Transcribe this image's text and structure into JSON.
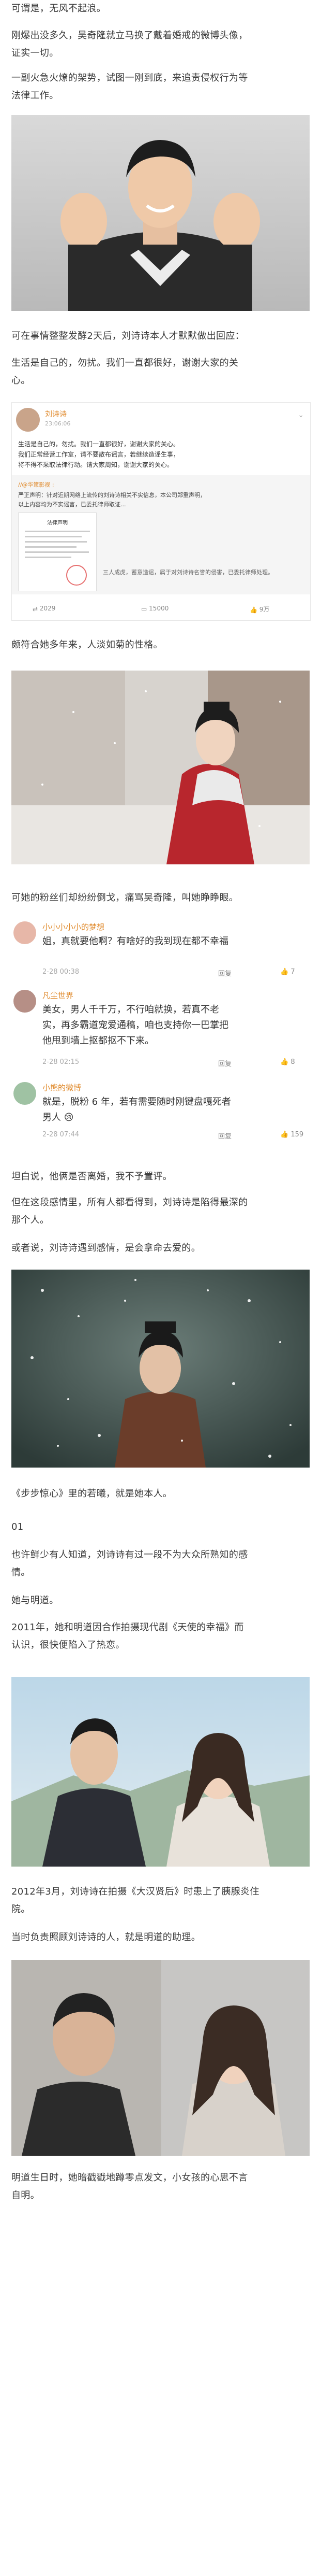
{
  "paragraphs": {
    "p1": "可谓是，无风不起浪。",
    "p2a": "刚爆出没多久，吴奇隆就立马换了戴着婚戒的微博头像，",
    "p2b": "证实一切。",
    "p3a": "一副火急火燎的架势，试图一刚到底，来追责侵权行为等",
    "p3b": "法律工作。",
    "p4": "可在事情整整发酵2天后，刘诗诗本人才默默做出回应：",
    "p5a": "生活是自己的，勿扰。我们一直都很好，谢谢大家的关",
    "p5b": "心。",
    "p6": "颇符合她多年来，人淡如菊的性格。",
    "p7": "可她的粉丝们却纷纷倒戈，痛骂吴奇隆，叫她睁睁眼。",
    "p8": "坦白说，他俩是否离婚，我不予置评。",
    "p9a": "但在这段感情里，所有人都看得到，刘诗诗是陷得最深的",
    "p9b": "那个人。",
    "p10": "或者说，刘诗诗遇到感情，是会拿命去爱的。",
    "p11": "《步步惊心》里的若曦，就是她本人。",
    "p12": "01",
    "p13a": "也许鲜少有人知道，刘诗诗有过一段不为大众所熟知的感",
    "p13b": "情。",
    "p14": "她与明道。",
    "p15a": "2011年，她和明道因合作拍摄现代剧《天使的幸福》而",
    "p15b": "认识，很快便陷入了热恋。",
    "p16a": "2012年3月，刘诗诗在拍摄《大汉贤后》时患上了胰腺炎住",
    "p16b": "院。",
    "p17": "当时负责照顾刘诗诗的人，就是明道的助理。",
    "p18a": "明道生日时，她暗戳戳地蹲零点发文，小女孩的心思不言",
    "p18b": "自明。"
  },
  "weibo_post": {
    "username": "刘诗诗",
    "time": "23:06:06",
    "line1": "生活是自己的，勿扰。我们一直都很好，谢谢大家的关心。",
    "line2": "我们正常经营工作室，请不要散布谣言，若继续造谣生事，",
    "line3": "将不得不采取法律行动。请大家周知，谢谢大家的关心。",
    "quote_header": "//@华策影视 :",
    "quote_body": "严正声明：针对近期网络上流传的刘诗诗相关不实信息，本公司郑重声明，",
    "quote_body2": "以上内容均为不实谣言，已委托律师取证...",
    "quote_more": "三人成虎，蓄意造谣，属于对刘诗诗名誉的侵害，已委托律师处理。",
    "doc_title": "法律声明",
    "actions": [
      "2029",
      "15000",
      "9万"
    ]
  },
  "comments": [
    {
      "name": "小小小小小的梦想",
      "text1": "姐，真就要他啊？有啥好的我到现在都不幸福",
      "text2": "",
      "time": "2-28 00:38",
      "replies": "回复",
      "likes": "7"
    },
    {
      "name": "凡尘世界",
      "text1": "美女，男人千千万，不行咱就换，若真不老",
      "text2": "实，再多霸道宠爱通稿，咱也支持你一巴掌把",
      "text3": "他甩到墙上抠都抠不下来。",
      "time": "2-28 02:15",
      "replies": "回复",
      "likes": "8"
    },
    {
      "name": "小熊的微博",
      "text1": "就是，脱粉 6 年，若有需要随时刚键盘嘎死者",
      "text2": "男人",
      "time": "2-28 07:44",
      "replies": "回复",
      "likes": "159"
    }
  ],
  "colors": {
    "text": "#3a3a3a",
    "accent": "#e08a2c"
  }
}
